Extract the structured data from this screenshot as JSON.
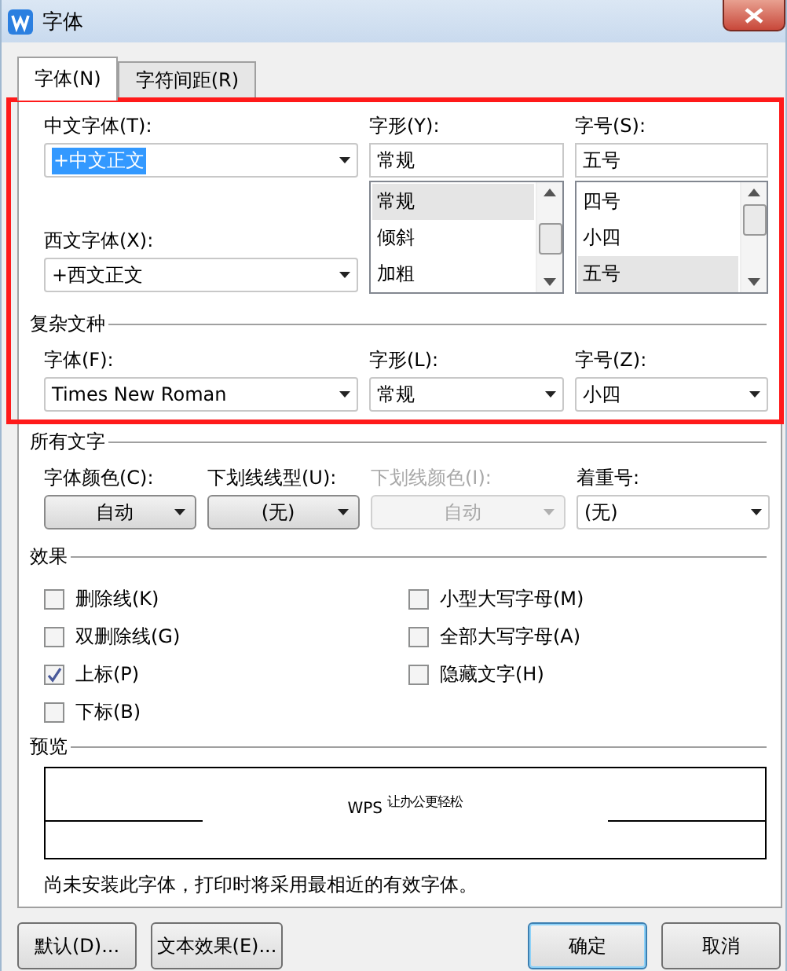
{
  "window": {
    "title": "字体"
  },
  "tabs": [
    {
      "label": "字体(N)",
      "selected": true
    },
    {
      "label": "字符间距(R)",
      "selected": false
    }
  ],
  "chinese_font": {
    "label": "中文字体(T):",
    "value": "+中文正文"
  },
  "western_font": {
    "label": "西文字体(X):",
    "value": "+西文正文"
  },
  "style": {
    "label": "字形(Y):",
    "value": "常规",
    "options": [
      {
        "label": "常规",
        "selected": true
      },
      {
        "label": "倾斜",
        "selected": false
      },
      {
        "label": "加粗",
        "selected": false
      }
    ]
  },
  "size": {
    "label": "字号(S):",
    "value": "五号",
    "options": [
      {
        "label": "四号",
        "selected": false
      },
      {
        "label": "小四",
        "selected": false
      },
      {
        "label": "五号",
        "selected": true
      }
    ]
  },
  "complex_script": {
    "title": "复杂文种",
    "fields": [
      {
        "label": "字体(F):",
        "value": "Times New Roman"
      },
      {
        "label": "字形(L):",
        "value": "常规"
      },
      {
        "label": "字号(Z):",
        "value": "小四"
      }
    ]
  },
  "all_text": {
    "title": "所有文字",
    "fields": [
      {
        "label": "字体颜色(C):",
        "value": "自动",
        "kind": "button",
        "disabled": false
      },
      {
        "label": "下划线线型(U):",
        "value": "(无)",
        "kind": "button",
        "disabled": false
      },
      {
        "label": "下划线颜色(I):",
        "value": "自动",
        "kind": "button",
        "disabled": true
      },
      {
        "label": "着重号:",
        "value": "(无)",
        "kind": "combo",
        "disabled": false
      }
    ]
  },
  "effects": {
    "title": "效果",
    "left": [
      {
        "label": "删除线(K)",
        "checked": false
      },
      {
        "label": "双删除线(G)",
        "checked": false
      },
      {
        "label": "上标(P)",
        "checked": true
      },
      {
        "label": "下标(B)",
        "checked": false
      }
    ],
    "right": [
      {
        "label": "小型大写字母(M)",
        "checked": false
      },
      {
        "label": "全部大写字母(A)",
        "checked": false
      },
      {
        "label": "隐藏文字(H)",
        "checked": false
      }
    ]
  },
  "preview": {
    "title": "预览",
    "sample": "WPS $^{让办公更轻松}$",
    "note": "尚未安装此字体，打印时将采用最相近的有效字体。"
  },
  "buttons": [
    {
      "label": "默认(D)...",
      "default": false
    },
    {
      "label": "文本效果(E)...",
      "default": false
    },
    {
      "label": "确定",
      "default": true
    },
    {
      "label": "取消",
      "default": false
    }
  ]
}
